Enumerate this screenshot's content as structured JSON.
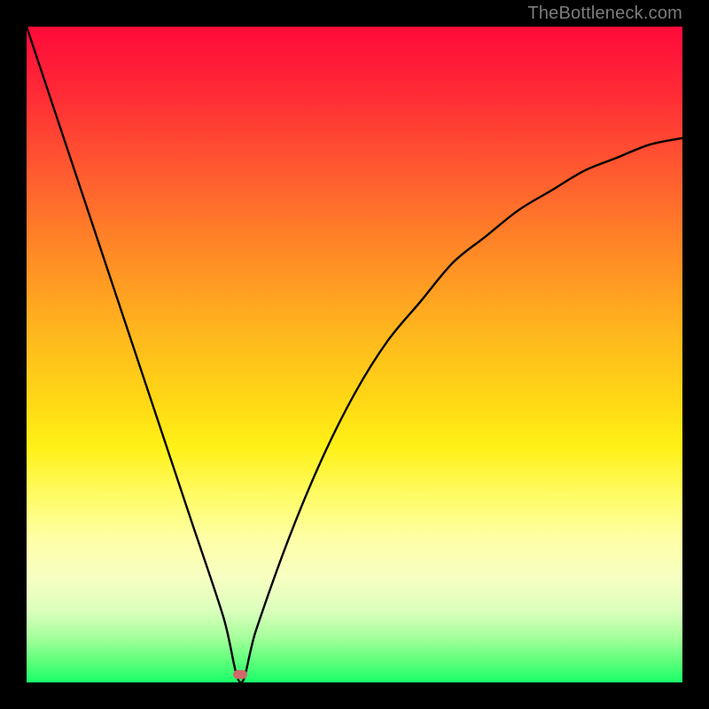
{
  "watermark": "TheBottleneck.com",
  "colors": {
    "background": "#000000",
    "gradient_top": "#ff0a3a",
    "gradient_bottom": "#18ff68",
    "curve": "#000000",
    "marker": "#ce6a6a"
  },
  "chart_data": {
    "type": "line",
    "title": "",
    "xlabel": "",
    "ylabel": "",
    "xlim": [
      0,
      100
    ],
    "ylim": [
      0,
      100
    ],
    "grid": false,
    "legend": false,
    "annotations": [
      {
        "text": "TheBottleneck.com",
        "position": "top-right"
      }
    ],
    "series": [
      {
        "name": "bottleneck-curve",
        "x": [
          0,
          5,
          10,
          15,
          20,
          25,
          30,
          32.6,
          35,
          40,
          45,
          50,
          55,
          60,
          65,
          70,
          75,
          80,
          85,
          90,
          95,
          100
        ],
        "values": [
          100,
          85,
          70,
          55,
          40,
          25,
          10,
          0,
          8,
          22,
          34,
          44,
          52,
          58,
          64,
          68,
          72,
          75,
          78,
          80,
          82,
          83
        ]
      }
    ],
    "marker": {
      "x": 32.6,
      "y": 1.2
    }
  }
}
